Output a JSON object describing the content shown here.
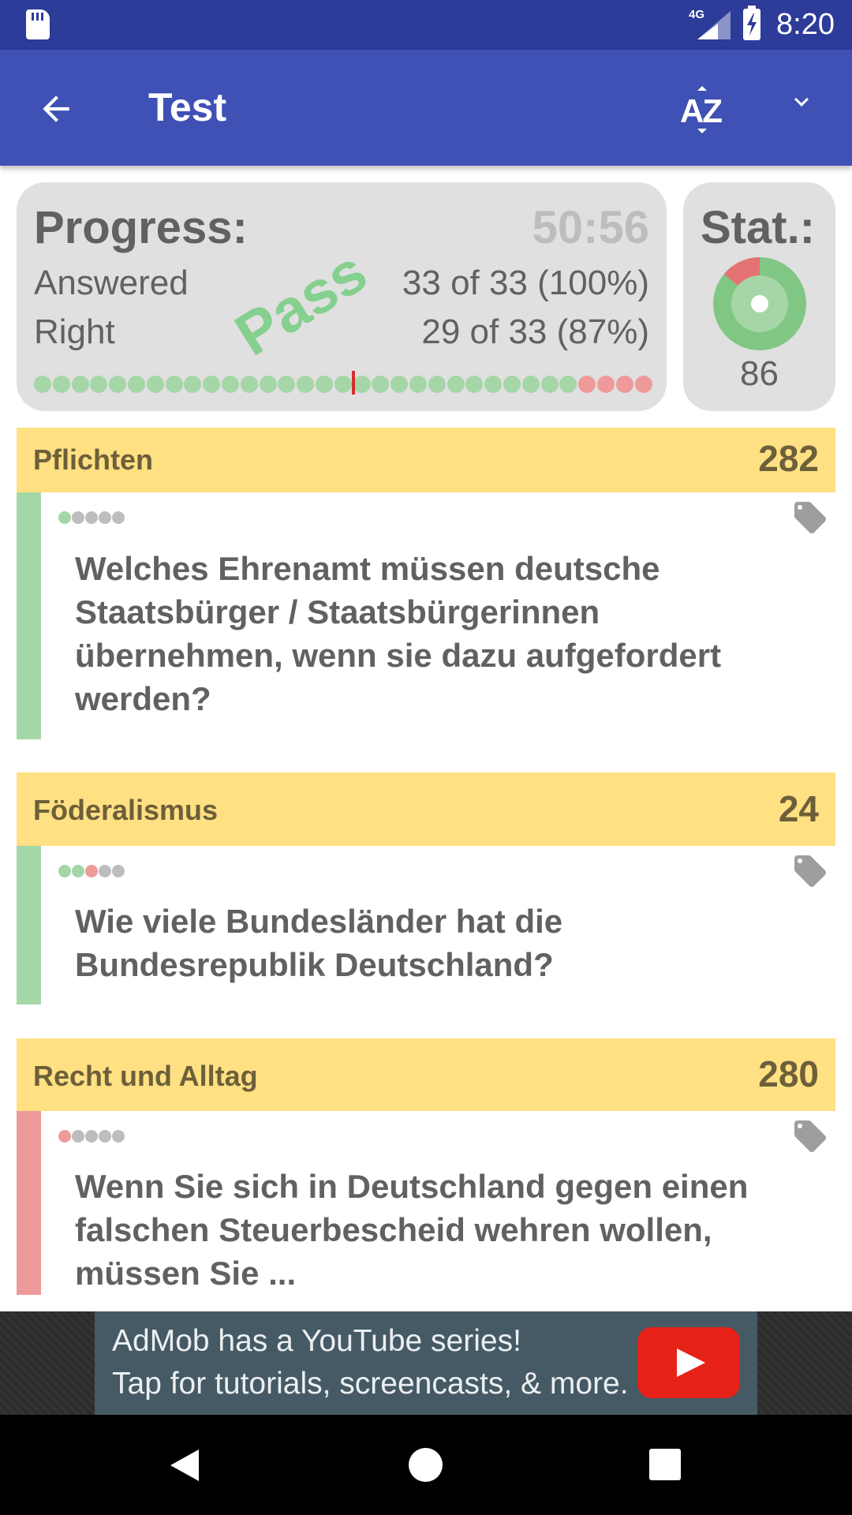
{
  "status_bar": {
    "network": "4G",
    "time": "8:20"
  },
  "app_bar": {
    "title": "Test",
    "sort_label": "AZ"
  },
  "progress": {
    "title": "Progress:",
    "timer": "50:56",
    "answered_label": "Answered",
    "answered_value": "33 of 33 (100%)",
    "right_label": "Right",
    "right_value": "29 of 33 (87%)",
    "stamp": "Pass",
    "answers": [
      "right",
      "right",
      "right",
      "right",
      "right",
      "right",
      "right",
      "right",
      "right",
      "right",
      "right",
      "right",
      "right",
      "right",
      "right",
      "right",
      "right",
      "right",
      "right",
      "right",
      "right",
      "right",
      "right",
      "right",
      "right",
      "right",
      "right",
      "right",
      "right",
      "wrong",
      "wrong",
      "wrong",
      "wrong"
    ],
    "marker_after_index": 16
  },
  "stat": {
    "title": "Stat.:",
    "value": "86",
    "right_fraction": 0.86
  },
  "questions": [
    {
      "category": "Pflichten",
      "count": "282",
      "status": "right",
      "history": [
        "right",
        "none",
        "none",
        "none",
        "none"
      ],
      "text": "Welches Ehrenamt müssen deutsche Staatsbürger / Staatsbürgerinnen übernehmen, wenn sie dazu aufgefordert werden?"
    },
    {
      "category": "Föderalismus",
      "count": "24",
      "status": "right",
      "history": [
        "right",
        "right",
        "wrong",
        "none",
        "none"
      ],
      "text": "Wie viele Bundesländer hat die Bundesrepublik Deutschland?"
    },
    {
      "category": "Recht und Alltag",
      "count": "280",
      "status": "wrong",
      "history": [
        "wrong",
        "none",
        "none",
        "none",
        "none"
      ],
      "text": "Wenn Sie sich in Deutschland gegen einen falschen Steuerbescheid wehren wollen, müssen Sie ..."
    }
  ],
  "ad": {
    "line1": "AdMob has a YouTube series!",
    "line2": "Tap for tutorials, screencasts, & more."
  },
  "colors": {
    "status_bar": "#2d3b99",
    "app_bar": "#3f51b5",
    "right": "#a5d6a7",
    "wrong": "#ef9a9a",
    "category_header": "#ffe082"
  }
}
